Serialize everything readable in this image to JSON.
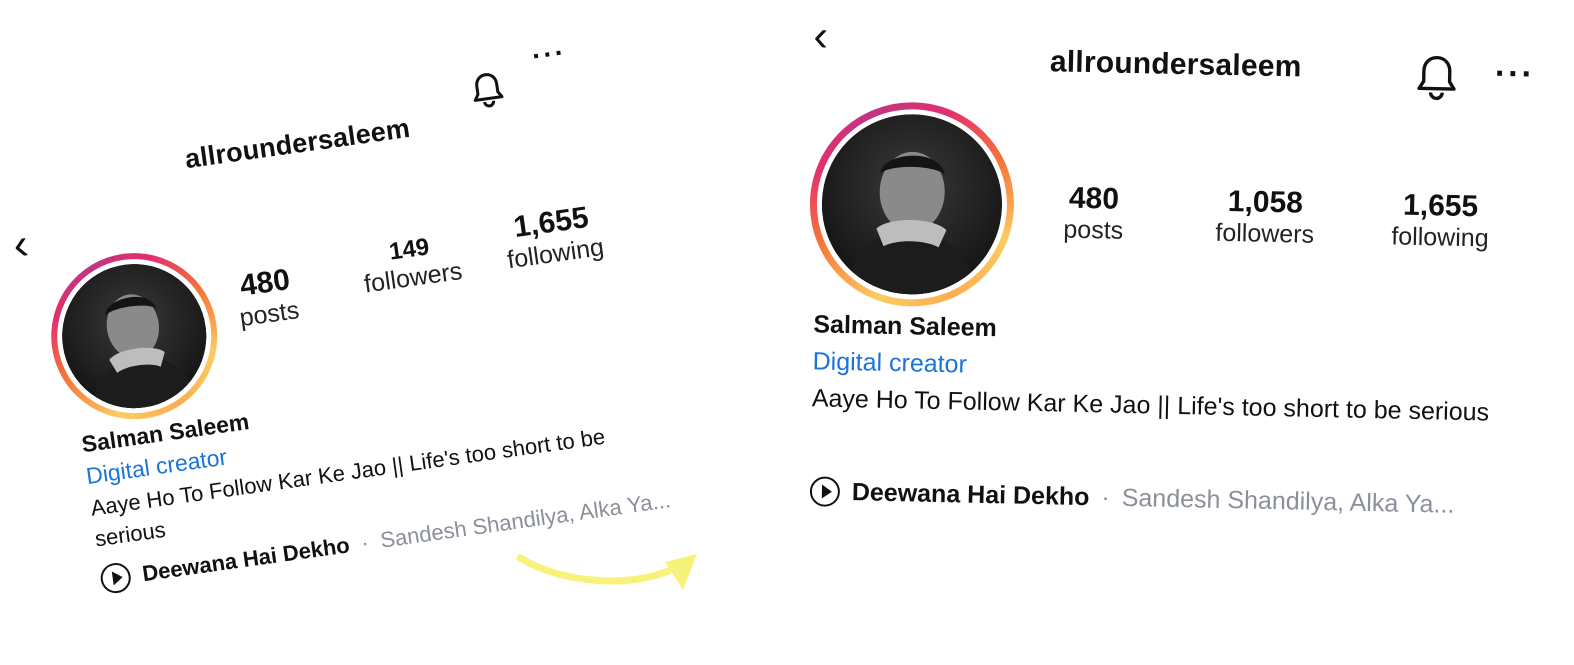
{
  "profile": {
    "username": "allroundersaleem",
    "name": "Salman Saleem",
    "category": "Digital creator",
    "bio": "Aaye Ho To Follow Kar Ke Jao || Life's too short to be serious",
    "music": {
      "song": "Deewana Hai Dekho",
      "separator": "·",
      "artists": "Sandesh Shandilya, Alka Ya..."
    }
  },
  "before": {
    "posts": "480",
    "posts_label": "posts",
    "followers": "149",
    "followers_label": "followers",
    "following": "1,655",
    "following_label": "following"
  },
  "after": {
    "posts": "480",
    "posts_label": "posts",
    "followers": "1,058",
    "followers_label": "followers",
    "following": "1,655",
    "following_label": "following"
  },
  "icons": {
    "back": "chevron-left-icon",
    "bell": "bell-icon",
    "more": "more-icon",
    "play": "play-circle-icon",
    "arrow": "curved-arrow-icon"
  },
  "colors": {
    "category": "#1b74d9",
    "arrow": "#f7f27a",
    "artists": "#8a8f99"
  }
}
